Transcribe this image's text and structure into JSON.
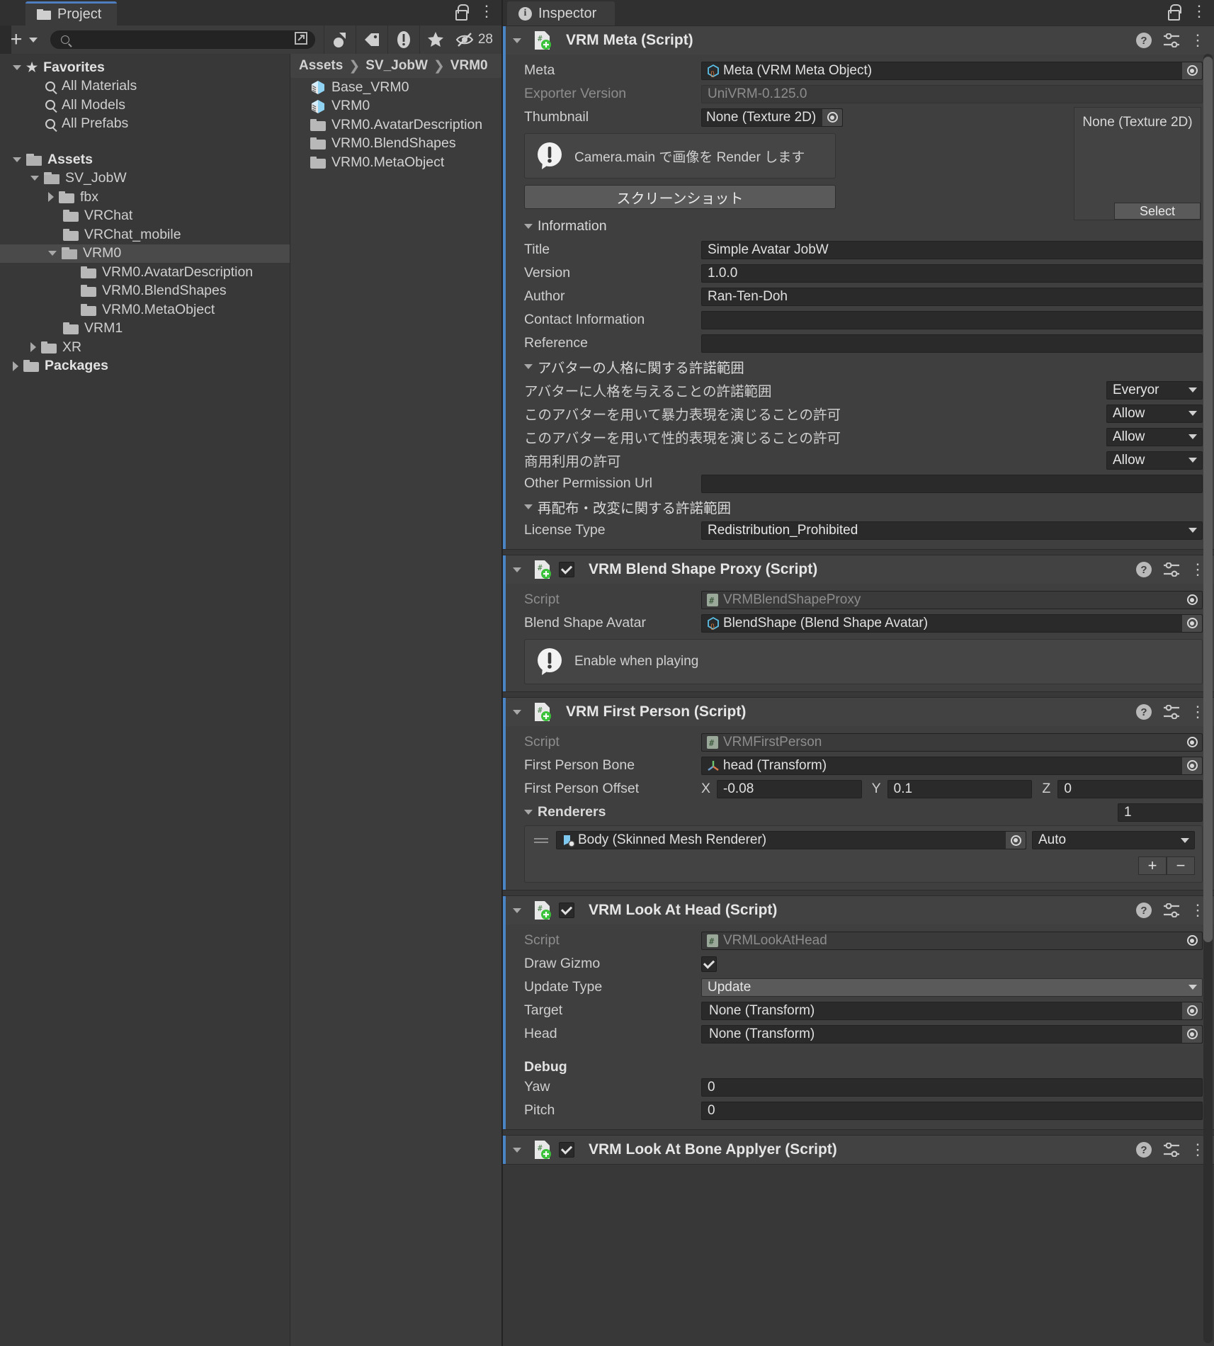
{
  "project_panel": {
    "tab_label": "Project",
    "icons": {
      "lock": "lock-icon",
      "menu": "kebab-menu-icon"
    },
    "toolbar": {
      "create_label": "+",
      "search_placeholder": "",
      "search_value": "",
      "hidden_count": "28"
    },
    "breadcrumb": [
      "Assets",
      "SV_JobW",
      "VRM0"
    ],
    "tree": [
      {
        "label": "Favorites",
        "depth": 0,
        "icon": "star-icon",
        "arrow": "down",
        "bold": true,
        "selected": false
      },
      {
        "label": "All Materials",
        "depth": 1,
        "icon": "search-icon",
        "arrow": "none",
        "bold": false,
        "selected": false
      },
      {
        "label": "All Models",
        "depth": 1,
        "icon": "search-icon",
        "arrow": "none",
        "bold": false,
        "selected": false
      },
      {
        "label": "All Prefabs",
        "depth": 1,
        "icon": "search-icon",
        "arrow": "none",
        "bold": false,
        "selected": false
      },
      {
        "label": "",
        "depth": 0,
        "icon": "none",
        "arrow": "none",
        "bold": false,
        "selected": false
      },
      {
        "label": "Assets",
        "depth": 0,
        "icon": "folder-open-icon",
        "arrow": "down",
        "bold": true,
        "selected": false
      },
      {
        "label": "SV_JobW",
        "depth": 1,
        "icon": "folder-open-icon",
        "arrow": "down",
        "bold": false,
        "selected": false
      },
      {
        "label": "fbx",
        "depth": 2,
        "icon": "folder-icon",
        "arrow": "right",
        "bold": false,
        "selected": false
      },
      {
        "label": "VRChat",
        "depth": 2,
        "icon": "folder-icon",
        "arrow": "none",
        "bold": false,
        "selected": false
      },
      {
        "label": "VRChat_mobile",
        "depth": 2,
        "icon": "folder-icon",
        "arrow": "none",
        "bold": false,
        "selected": false
      },
      {
        "label": "VRM0",
        "depth": 2,
        "icon": "folder-open-icon",
        "arrow": "down",
        "bold": false,
        "selected": true
      },
      {
        "label": "VRM0.AvatarDescription",
        "depth": 3,
        "icon": "folder-icon",
        "arrow": "none",
        "bold": false,
        "selected": false
      },
      {
        "label": "VRM0.BlendShapes",
        "depth": 3,
        "icon": "folder-icon",
        "arrow": "none",
        "bold": false,
        "selected": false
      },
      {
        "label": "VRM0.MetaObject",
        "depth": 3,
        "icon": "folder-icon",
        "arrow": "none",
        "bold": false,
        "selected": false
      },
      {
        "label": "VRM1",
        "depth": 2,
        "icon": "folder-icon",
        "arrow": "none",
        "bold": false,
        "selected": false
      },
      {
        "label": "XR",
        "depth": 1,
        "icon": "folder-icon",
        "arrow": "right",
        "bold": false,
        "selected": false
      },
      {
        "label": "Packages",
        "depth": 0,
        "icon": "folder-icon",
        "arrow": "right",
        "bold": true,
        "selected": false
      }
    ],
    "assets": [
      {
        "label": "Base_VRM0",
        "icon": "prefab-icon"
      },
      {
        "label": "VRM0",
        "icon": "prefab-icon"
      },
      {
        "label": "VRM0.AvatarDescription",
        "icon": "folder-icon"
      },
      {
        "label": "VRM0.BlendShapes",
        "icon": "folder-icon"
      },
      {
        "label": "VRM0.MetaObject",
        "icon": "folder-icon"
      }
    ]
  },
  "inspector": {
    "tab_label": "Inspector",
    "components": [
      {
        "title": "VRM Meta (Script)",
        "has_enable_checkbox": false,
        "enabled": false
      },
      {
        "title": "VRM Blend Shape Proxy (Script)",
        "has_enable_checkbox": true,
        "enabled": true
      },
      {
        "title": "VRM First Person (Script)",
        "has_enable_checkbox": false,
        "enabled": false
      },
      {
        "title": "VRM Look At Head (Script)",
        "has_enable_checkbox": true,
        "enabled": true
      },
      {
        "title": "VRM Look At Bone Applyer (Script)",
        "has_enable_checkbox": true,
        "enabled": true
      }
    ],
    "vrm_meta": {
      "meta_label": "Meta",
      "meta_value": "Meta (VRM Meta Object)",
      "exporter_label": "Exporter Version",
      "exporter_value": "UniVRM-0.125.0",
      "thumbnail_label": "Thumbnail",
      "thumbnail_value": "None (Texture 2D)",
      "helpbox": "Camera.main で画像を Render します",
      "screenshot_button": "スクリーンショット",
      "texture_preview_label": "None (Texture 2D)",
      "texture_select_button": "Select",
      "information_foldout": "Information",
      "title_label": "Title",
      "title_value": "Simple Avatar JobW",
      "version_label": "Version",
      "version_value": "1.0.0",
      "author_label": "Author",
      "author_value": "Ran-Ten-Doh",
      "contact_label": "Contact Information",
      "contact_value": "",
      "reference_label": "Reference",
      "reference_value": "",
      "personality_foldout": "アバターの人格に関する許諾範囲",
      "allowed_user_label": "アバターに人格を与えることの許諾範囲",
      "allowed_user_value": "Everyor",
      "violent_label": "このアバターを用いて暴力表現を演じることの許可",
      "violent_value": "Allow",
      "sexual_label": "このアバターを用いて性的表現を演じることの許可",
      "sexual_value": "Allow",
      "commercial_label": "商用利用の許可",
      "commercial_value": "Allow",
      "other_permission_label": "Other Permission Url",
      "other_permission_value": "",
      "redistribution_foldout": "再配布・改変に関する許諾範囲",
      "license_label": "License Type",
      "license_value": "Redistribution_Prohibited"
    },
    "blend_shape_proxy": {
      "script_label": "Script",
      "script_value": "VRMBlendShapeProxy",
      "avatar_label": "Blend Shape Avatar",
      "avatar_value": "BlendShape (Blend Shape Avatar)",
      "helpbox": "Enable when playing"
    },
    "first_person": {
      "script_label": "Script",
      "script_value": "VRMFirstPerson",
      "bone_label": "First Person Bone",
      "bone_value": "head (Transform)",
      "offset_label": "First Person Offset",
      "offset_x_axis": "X",
      "offset_x": "-0.08",
      "offset_y_axis": "Y",
      "offset_y": "0.1",
      "offset_z_axis": "Z",
      "offset_z": "0",
      "renderers_foldout": "Renderers",
      "renderers_size": "1",
      "renderer_item": "Body (Skinned Mesh Renderer)",
      "renderer_flag": "Auto",
      "add_button": "+",
      "remove_button": "−"
    },
    "look_at_head": {
      "script_label": "Script",
      "script_value": "VRMLookAtHead",
      "draw_gizmo_label": "Draw Gizmo",
      "draw_gizmo_checked": true,
      "update_type_label": "Update Type",
      "update_type_value": "Update",
      "target_label": "Target",
      "target_value": "None (Transform)",
      "head_label": "Head",
      "head_value": "None (Transform)",
      "debug_label": "Debug",
      "yaw_label": "Yaw",
      "yaw_value": "0",
      "pitch_label": "Pitch",
      "pitch_value": "0"
    }
  },
  "colors": {
    "accent": "#4a84c4",
    "panel_bg": "#383838",
    "component_bg": "#3f3f3f",
    "field_bg": "#2a2a2a",
    "selection": "#4a4a4a"
  }
}
